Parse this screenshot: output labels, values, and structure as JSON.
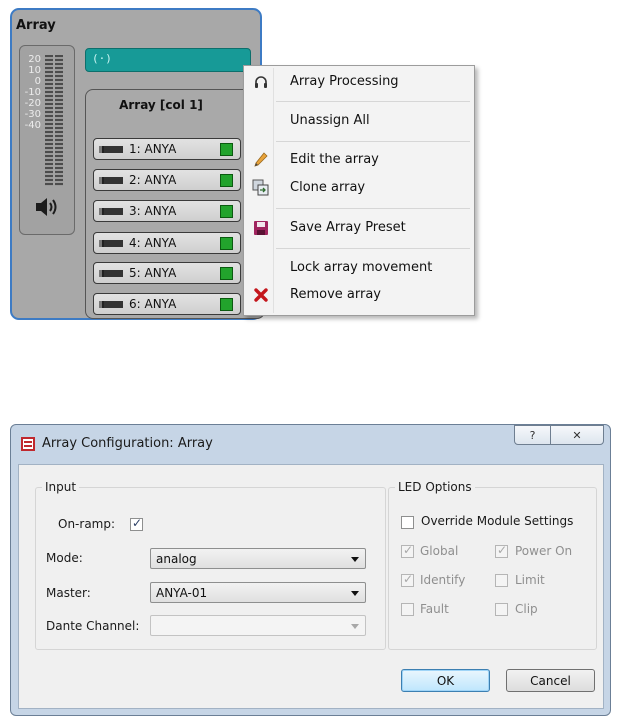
{
  "array_panel": {
    "title": "Array",
    "meter_scale": [
      "20",
      "10",
      "0",
      "-10",
      "-20",
      "-30",
      "-40"
    ],
    "column_title": "Array [col 1]",
    "signal_icon": "(·)",
    "modules": [
      {
        "label": "1: ANYA"
      },
      {
        "label": "2: ANYA"
      },
      {
        "label": "3: ANYA"
      },
      {
        "label": "4: ANYA"
      },
      {
        "label": "5: ANYA"
      },
      {
        "label": "6: ANYA"
      }
    ],
    "led_color": "#22a32c",
    "accent_color": "#179a97"
  },
  "context_menu": {
    "items": [
      {
        "label": "Array Processing",
        "icon": "headphones-icon"
      },
      {
        "label": "Unassign All",
        "icon": ""
      },
      {
        "label": "Edit the array",
        "icon": "pencil-icon"
      },
      {
        "label": "Clone array",
        "icon": "clone-icon"
      },
      {
        "label": "Save Array Preset",
        "icon": "save-icon"
      },
      {
        "label": "Lock array movement",
        "icon": ""
      },
      {
        "label": "Remove array",
        "icon": "red-x-icon"
      }
    ]
  },
  "dialog": {
    "title": "Array Configuration: Array",
    "help_glyph": "?",
    "close_glyph": "✕",
    "input": {
      "title": "Input",
      "onramp_label": "On-ramp:",
      "onramp_checked": true,
      "mode_label": "Mode:",
      "mode_value": "analog",
      "master_label": "Master:",
      "master_value": "ANYA-01",
      "dante_label": "Dante Channel:",
      "dante_value": ""
    },
    "led": {
      "title": "LED Options",
      "override_label": "Override Module Settings",
      "global_label": "Global",
      "power_on_label": "Power On",
      "identify_label": "Identify",
      "limit_label": "Limit",
      "fault_label": "Fault",
      "clip_label": "Clip"
    },
    "ok_label": "OK",
    "cancel_label": "Cancel"
  }
}
